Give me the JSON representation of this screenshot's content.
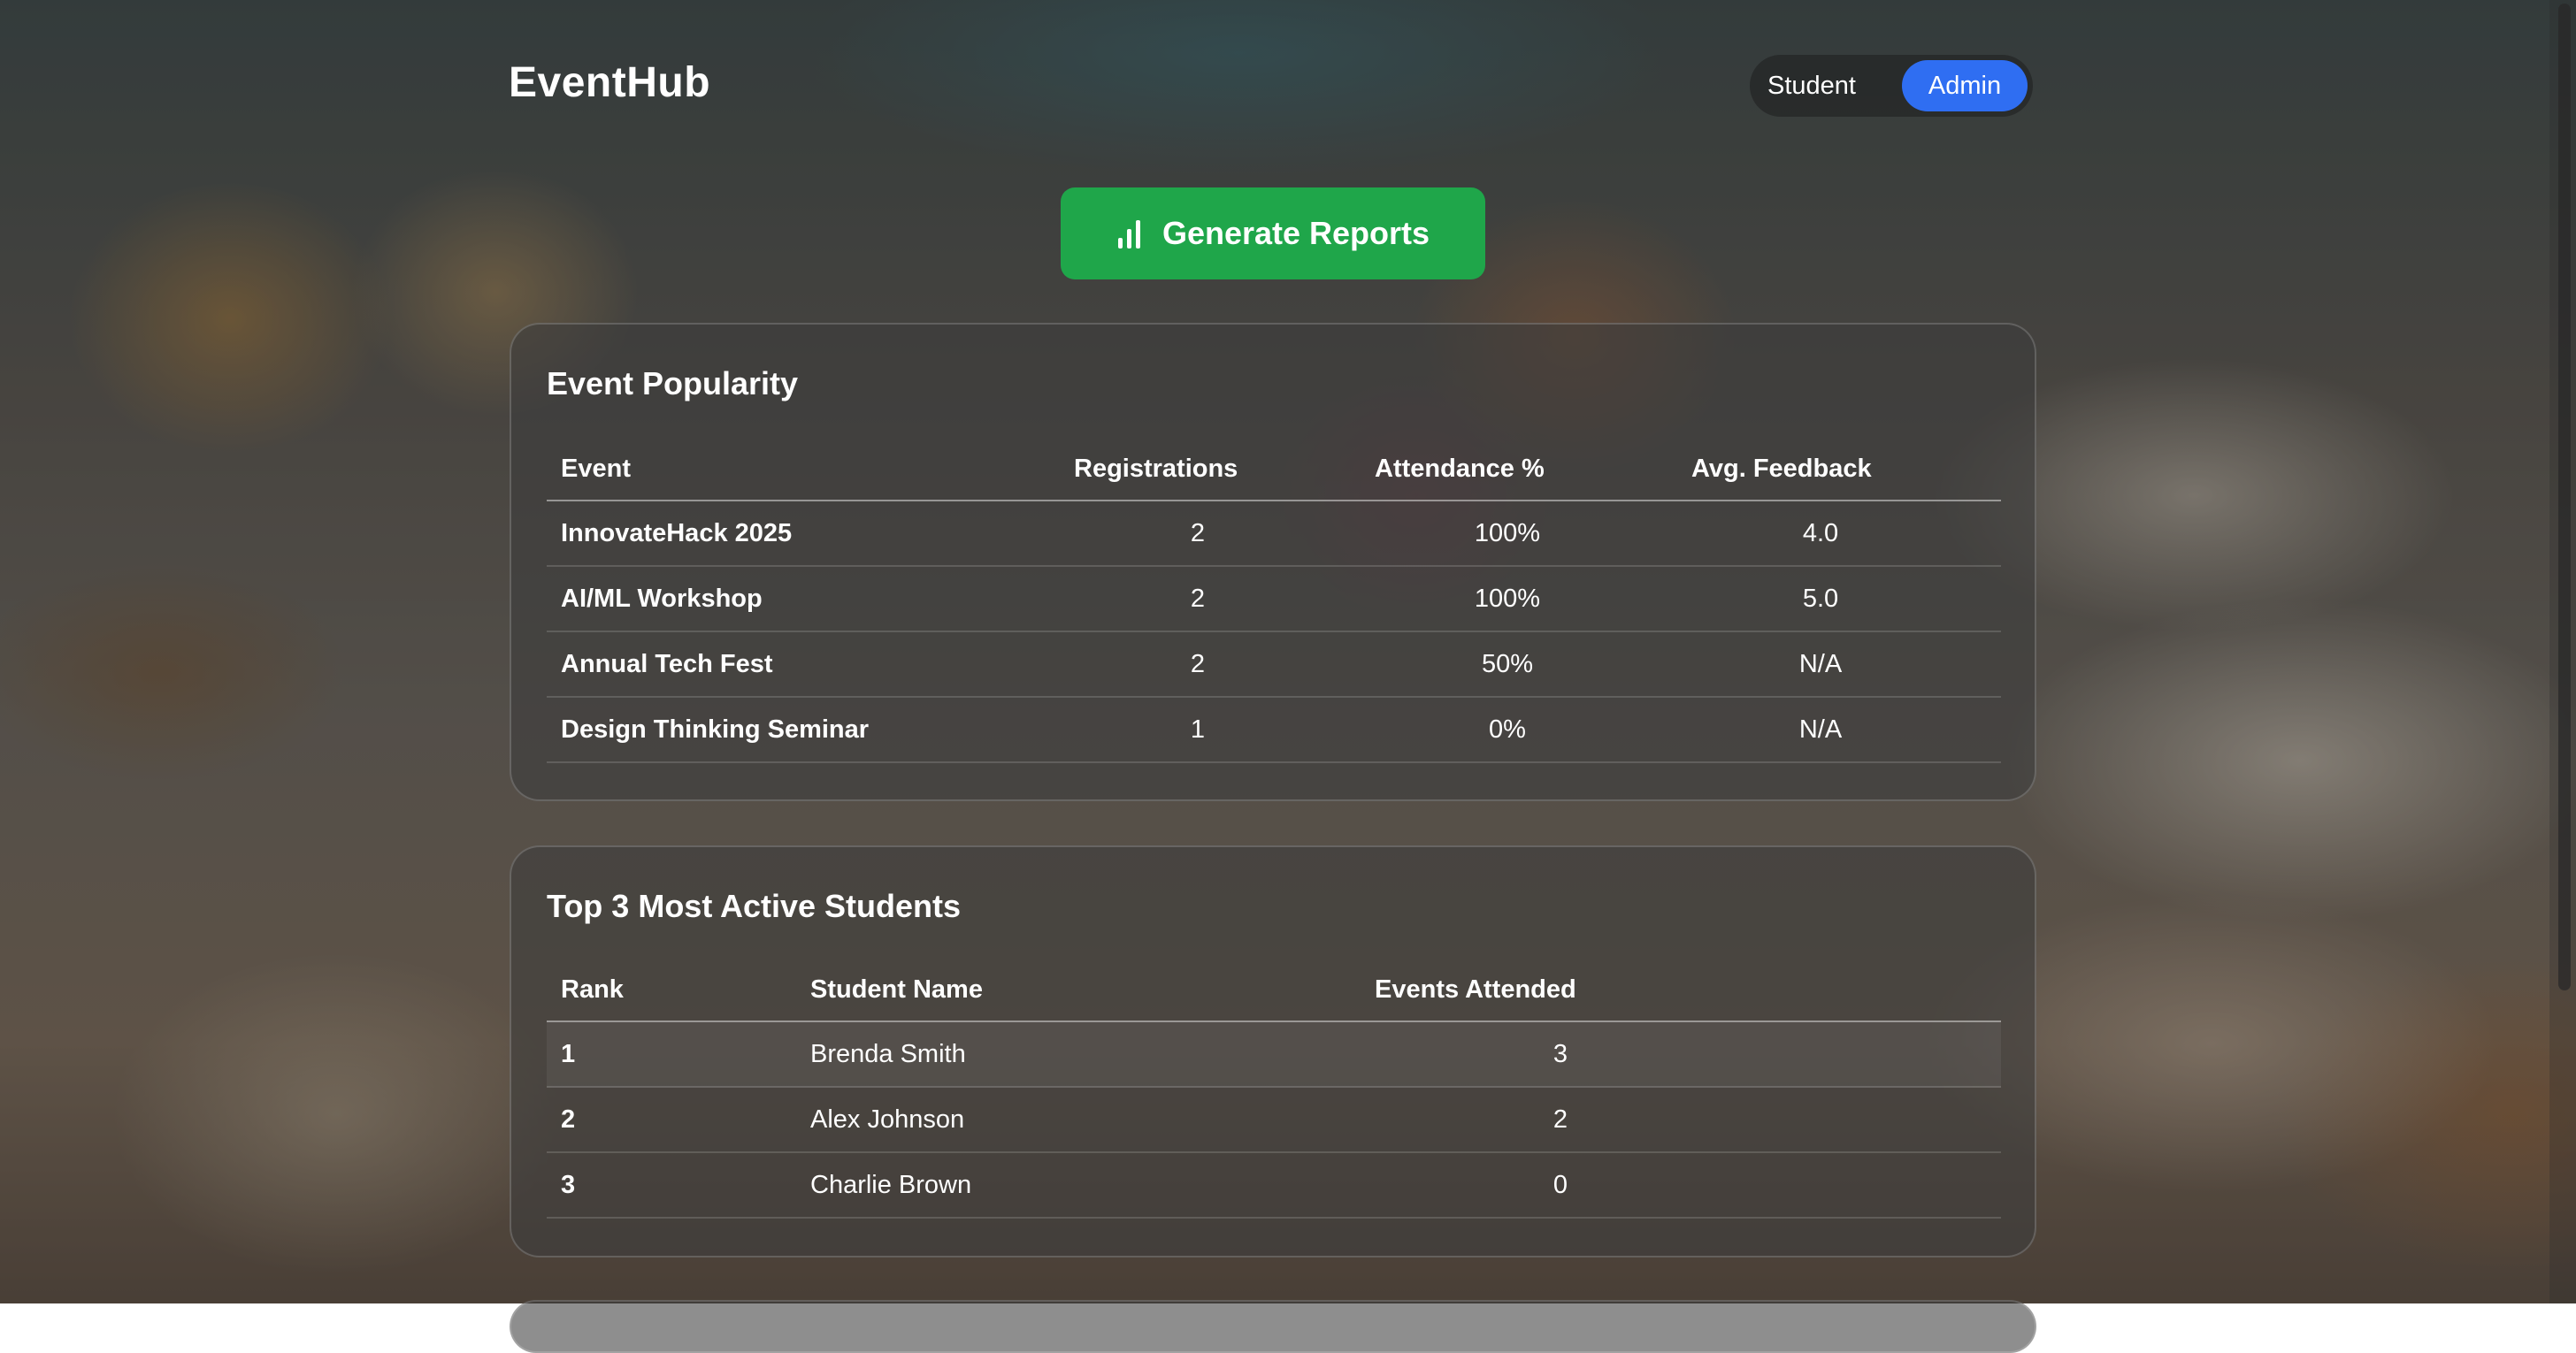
{
  "app": {
    "brand": "EventHub",
    "roles": [
      "Student",
      "Admin"
    ],
    "active_role": "Admin"
  },
  "actions": {
    "generate_reports": "Generate Reports",
    "generate_reports_icon": "bar-chart-icon"
  },
  "event_popularity": {
    "title": "Event Popularity",
    "columns": [
      "Event",
      "Registrations",
      "Attendance %",
      "Avg. Feedback"
    ],
    "rows": [
      {
        "event": "InnovateHack 2025",
        "registrations": "2",
        "attendance": "100%",
        "feedback": "4.0"
      },
      {
        "event": "AI/ML Workshop",
        "registrations": "2",
        "attendance": "100%",
        "feedback": "5.0"
      },
      {
        "event": "Annual Tech Fest",
        "registrations": "2",
        "attendance": "50%",
        "feedback": "N/A"
      },
      {
        "event": "Design Thinking Seminar",
        "registrations": "1",
        "attendance": "0%",
        "feedback": "N/A"
      }
    ]
  },
  "top_students": {
    "title": "Top 3 Most Active Students",
    "columns": [
      "Rank",
      "Student Name",
      "Events Attended"
    ],
    "rows": [
      {
        "rank": "1",
        "name": "Brenda Smith",
        "events": "3"
      },
      {
        "rank": "2",
        "name": "Alex Johnson",
        "events": "2"
      },
      {
        "rank": "3",
        "name": "Charlie Brown",
        "events": "0"
      }
    ]
  },
  "colors": {
    "accent_blue": "#2f6ef2",
    "action_green": "#1fa64a"
  }
}
